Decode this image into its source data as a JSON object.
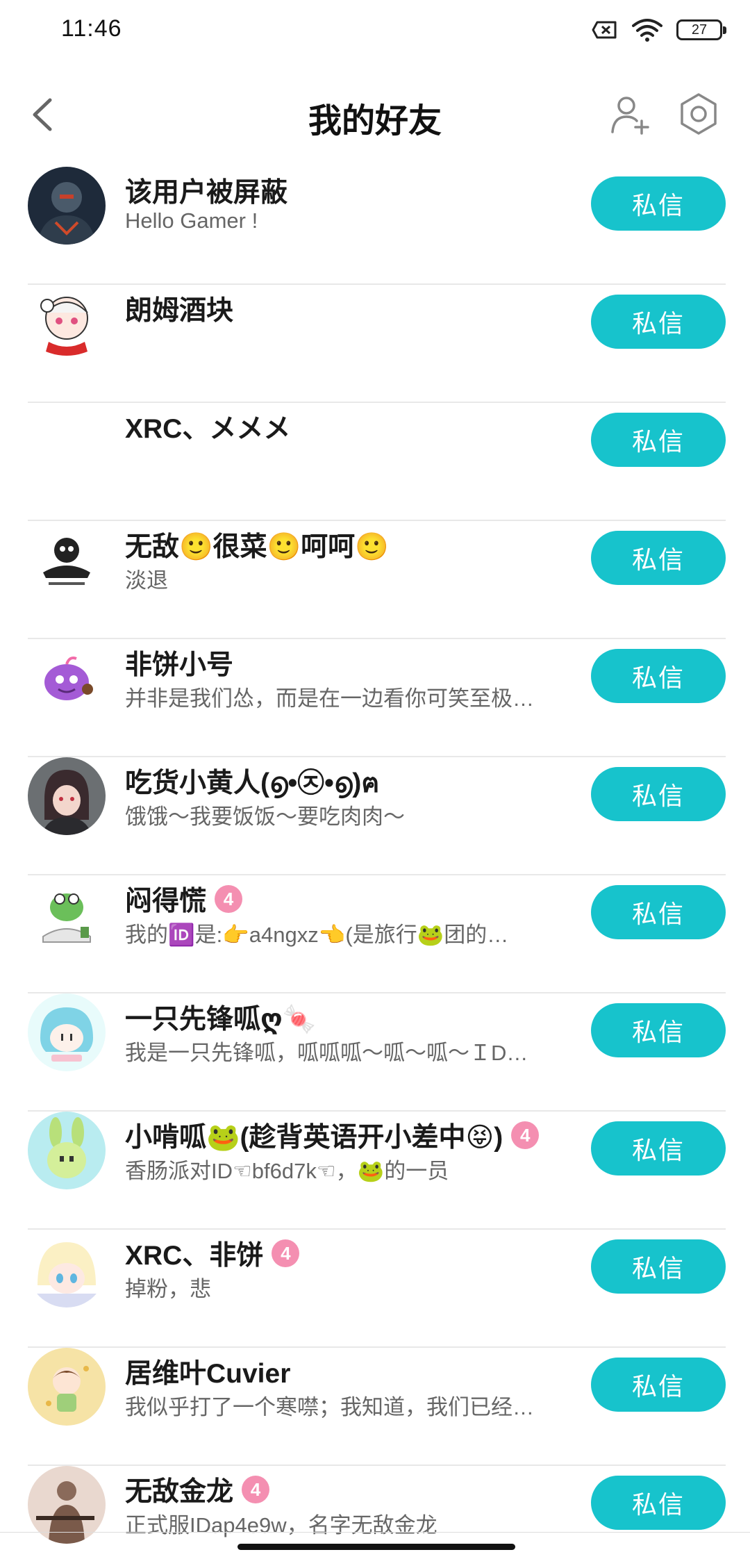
{
  "status_bar": {
    "time": "11:46",
    "battery": "27"
  },
  "header": {
    "title": "我的好友"
  },
  "colors": {
    "accent": "#17c3cc",
    "badge": "#f48fb1"
  },
  "dm_label": "私信",
  "friends": [
    {
      "name": "该用户被屏蔽",
      "signature": "Hello Gamer !",
      "badge": "",
      "avatar": "dark-armor-avatar"
    },
    {
      "name": "朗姆酒块",
      "signature": "",
      "badge": "",
      "avatar": "anime-girl-red-scarf-avatar"
    },
    {
      "name": "XRC、メメメ",
      "signature": "",
      "badge": "",
      "avatar": "blank-avatar"
    },
    {
      "name": "无敌🙂很菜🙂呵呵🙂",
      "signature": "淡退",
      "badge": "",
      "avatar": "meme-face-avatar"
    },
    {
      "name": "非饼小号",
      "signature": "并非是我们怂，而是在一边看你可笑至极…",
      "badge": "",
      "avatar": "purple-monster-avatar"
    },
    {
      "name": "吃货小黄人(൭•㉨•൭)ฅ",
      "signature": "饿饿～我要饭饭～要吃肉肉～",
      "badge": "",
      "avatar": "dark-hair-girl-avatar"
    },
    {
      "name": "闷得慌",
      "signature": "我的🆔是:👉a4ngxz👈(是旅行🐸团的…",
      "badge": "4",
      "avatar": "frog-avatar"
    },
    {
      "name": "一只先锋呱ღ🍬",
      "signature": "我是一只先锋呱，呱呱呱～呱～呱～ＩD…",
      "badge": "",
      "avatar": "blue-hair-chibi-avatar"
    },
    {
      "name": "小啃呱🐸(趁背英语开小差中😝)",
      "signature": "香肠派对ID☜bf6d7k☜，🐸的一员",
      "badge": "4",
      "avatar": "green-bunny-avatar"
    },
    {
      "name": "XRC、非饼",
      "signature": "掉粉，悲",
      "badge": "4",
      "avatar": "blonde-anime-avatar"
    },
    {
      "name": "居维叶Cuvier",
      "signature": "我似乎打了一个寒噤；我知道，我们已经…",
      "badge": "",
      "avatar": "chibi-boy-yellow-avatar"
    },
    {
      "name": "无敌金龙",
      "signature": "正式服IDap4e9w，名字无敌金龙",
      "badge": "4",
      "avatar": "soldier-avatar"
    }
  ]
}
